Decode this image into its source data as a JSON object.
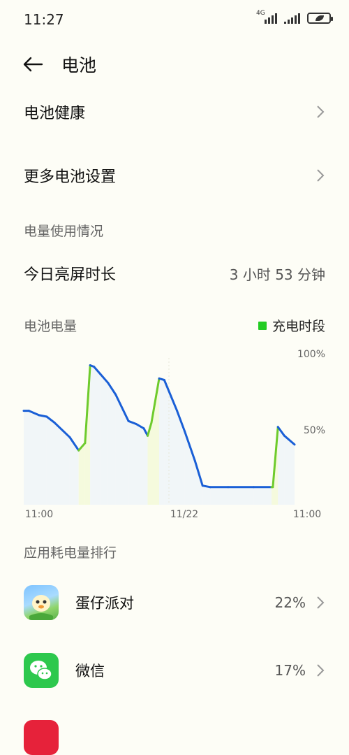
{
  "status": {
    "time": "11:27",
    "network": "4G"
  },
  "header": {
    "title": "电池"
  },
  "menu": {
    "battery_health": "电池健康",
    "more_settings": "更多电池设置"
  },
  "usage": {
    "section_title": "电量使用情况",
    "screen_on_label": "今日亮屏时长",
    "screen_on_value": "3 小时 53 分钟"
  },
  "battery_chart": {
    "title": "电池电量",
    "legend_label": "充电时段"
  },
  "chart_data": {
    "type": "line",
    "x_tick_labels": [
      "11:00",
      "11/22",
      "11:00"
    ],
    "y_tick_labels": [
      "100%",
      "50%"
    ],
    "ylim": [
      0,
      100
    ],
    "series": [
      {
        "points": [
          {
            "x": 0.0,
            "y": 64,
            "charging": true
          },
          {
            "x": 0.02,
            "y": 64,
            "charging": false
          },
          {
            "x": 0.06,
            "y": 61,
            "charging": false
          },
          {
            "x": 0.09,
            "y": 60,
            "charging": false
          },
          {
            "x": 0.12,
            "y": 56,
            "charging": false
          },
          {
            "x": 0.18,
            "y": 46,
            "charging": false
          },
          {
            "x": 0.215,
            "y": 37,
            "charging": false
          },
          {
            "x": 0.24,
            "y": 42,
            "charging": true
          },
          {
            "x": 0.26,
            "y": 95,
            "charging": true
          },
          {
            "x": 0.275,
            "y": 94,
            "charging": false
          },
          {
            "x": 0.3,
            "y": 89,
            "charging": false
          },
          {
            "x": 0.33,
            "y": 83,
            "charging": false
          },
          {
            "x": 0.36,
            "y": 75,
            "charging": false
          },
          {
            "x": 0.41,
            "y": 57,
            "charging": false
          },
          {
            "x": 0.44,
            "y": 55,
            "charging": false
          },
          {
            "x": 0.47,
            "y": 52,
            "charging": false
          },
          {
            "x": 0.485,
            "y": 47,
            "charging": false
          },
          {
            "x": 0.5,
            "y": 56,
            "charging": true
          },
          {
            "x": 0.53,
            "y": 86,
            "charging": true
          },
          {
            "x": 0.55,
            "y": 85,
            "charging": false
          },
          {
            "x": 0.6,
            "y": 64,
            "charging": false
          },
          {
            "x": 0.63,
            "y": 50,
            "charging": false
          },
          {
            "x": 0.67,
            "y": 30,
            "charging": false
          },
          {
            "x": 0.7,
            "y": 13,
            "charging": false
          },
          {
            "x": 0.73,
            "y": 12,
            "charging": false
          },
          {
            "x": 0.8,
            "y": 12,
            "charging": false
          },
          {
            "x": 0.9,
            "y": 12,
            "charging": false
          },
          {
            "x": 0.97,
            "y": 12,
            "charging": false
          },
          {
            "x": 0.975,
            "y": 12,
            "charging": true
          },
          {
            "x": 0.995,
            "y": 53,
            "charging": true
          },
          {
            "x": 1.02,
            "y": 47,
            "charging": false
          },
          {
            "x": 1.06,
            "y": 41,
            "charging": false
          }
        ]
      }
    ],
    "colors": {
      "discharge": "#1a5fd6",
      "charge": "#6ecb2c"
    }
  },
  "ranking": {
    "section_title": "应用耗电量排行",
    "apps": [
      {
        "name": "蛋仔派对",
        "percent": "22%",
        "icon": "eggy-party-icon"
      },
      {
        "name": "微信",
        "percent": "17%",
        "icon": "wechat-icon"
      }
    ]
  }
}
